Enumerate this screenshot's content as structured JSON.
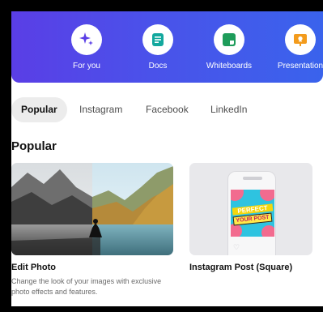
{
  "shortcuts": [
    {
      "label": "For you",
      "icon": "sparkle-icon",
      "color": "#5b3fe6"
    },
    {
      "label": "Docs",
      "icon": "document-icon",
      "color": "#13a89e"
    },
    {
      "label": "Whiteboards",
      "icon": "whiteboard-icon",
      "color": "#1e9c5a"
    },
    {
      "label": "Presentation",
      "icon": "presentation-icon",
      "color": "#f39b1c"
    }
  ],
  "tabs": [
    {
      "label": "Popular",
      "active": true
    },
    {
      "label": "Instagram",
      "active": false
    },
    {
      "label": "Facebook",
      "active": false
    },
    {
      "label": "LinkedIn",
      "active": false
    }
  ],
  "section": {
    "title": "Popular"
  },
  "cards": [
    {
      "title": "Edit Photo",
      "description": "Change the look of your images with exclusive photo effects and features."
    },
    {
      "title": "Instagram Post (Square)",
      "poster_line1": "PERFECT",
      "poster_line2": "YOUR POST"
    }
  ],
  "colors": {
    "hero_start": "#5a3ee6",
    "hero_end": "#3a63ec",
    "active_tab_bg": "#ececec"
  }
}
